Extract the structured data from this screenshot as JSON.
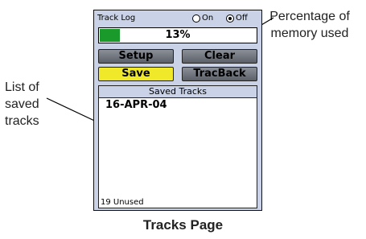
{
  "device": {
    "header_title": "Track Log",
    "on_label": "On",
    "off_label": "Off",
    "selected_mode": "Off",
    "memory_used_text": "13%",
    "memory_used_fraction": 0.13,
    "buttons": {
      "setup": "Setup",
      "clear": "Clear",
      "save": "Save",
      "tracback": "TracBack"
    },
    "saved_tracks_title": "Saved Tracks",
    "saved_tracks": [
      "16-APR-04"
    ],
    "unused_text": "19 Unused"
  },
  "annotations": {
    "memory": "Percentage of memory used",
    "list": "List of saved tracks"
  },
  "caption": "Tracks Page",
  "colors": {
    "progress_fill": "#1a9a2a",
    "save_button": "#f0e92a",
    "screen_bg": "#c9d2e6"
  }
}
